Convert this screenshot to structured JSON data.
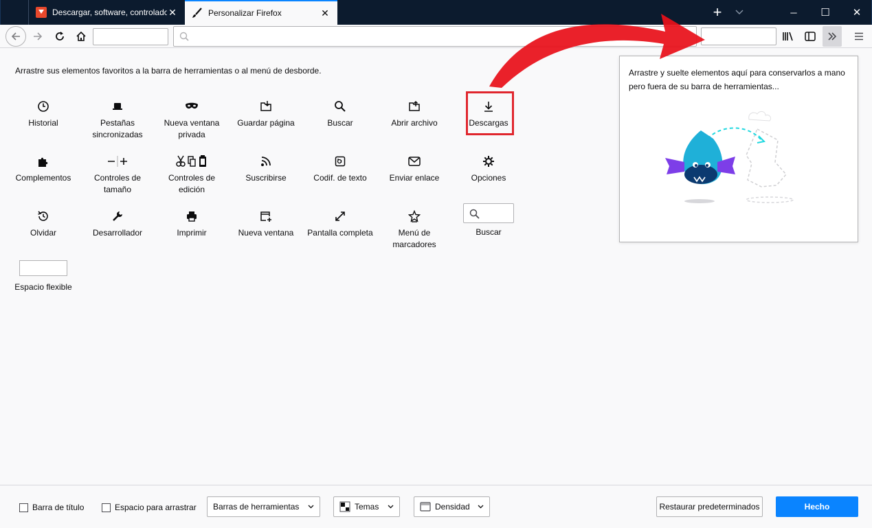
{
  "tabs": [
    {
      "label": "Descargar, software, controlado",
      "close": "✕"
    },
    {
      "label": "Personalizar Firefox",
      "close": "✕"
    }
  ],
  "window": {
    "new_tab": "+",
    "minimize": "─",
    "maximize": "☐",
    "close": "✕"
  },
  "instructions": "Arrastre sus elementos favoritos a la barra de herramientas o al menú de desborde.",
  "items": [
    {
      "label": "Historial",
      "icon": "clock-icon"
    },
    {
      "label": "Pestañas sincronizadas",
      "icon": "laptop-icon"
    },
    {
      "label": "Nueva ventana privada",
      "icon": "mask-icon"
    },
    {
      "label": "Guardar página",
      "icon": "save-page-icon"
    },
    {
      "label": "Buscar",
      "icon": "search-icon"
    },
    {
      "label": "Abrir archivo",
      "icon": "open-file-icon"
    },
    {
      "label": "Descargas",
      "icon": "download-icon"
    },
    {
      "label": "Complementos",
      "icon": "puzzle-icon"
    },
    {
      "label": "Controles de tamaño",
      "icon": "zoom-icon"
    },
    {
      "label": "Controles de edición",
      "icon": "edit-icon"
    },
    {
      "label": "Suscribirse",
      "icon": "rss-icon"
    },
    {
      "label": "Codif. de texto",
      "icon": "encoding-icon"
    },
    {
      "label": "Enviar enlace",
      "icon": "mail-icon"
    },
    {
      "label": "Opciones",
      "icon": "gear-icon"
    },
    {
      "label": "Olvidar",
      "icon": "forget-icon"
    },
    {
      "label": "Desarrollador",
      "icon": "wrench-icon"
    },
    {
      "label": "Imprimir",
      "icon": "printer-icon"
    },
    {
      "label": "Nueva ventana",
      "icon": "new-window-icon"
    },
    {
      "label": "Pantalla completa",
      "icon": "fullscreen-icon"
    },
    {
      "label": "Menú de marcadores",
      "icon": "star-icon"
    },
    {
      "label": "Buscar",
      "icon": "search-box-icon"
    },
    {
      "label": "Espacio flexible",
      "icon": "flexible-space-icon"
    }
  ],
  "overflow_panel": {
    "text": "Arrastre y suelte elementos aquí para conservarlos a mano pero fuera de su barra de herramientas..."
  },
  "footer": {
    "title_bar": "Barra de título",
    "drag_space": "Espacio para arrastrar",
    "toolbars": "Barras de herramientas",
    "themes": "Temas",
    "density": "Densidad",
    "restore": "Restaurar predeterminados",
    "done": "Hecho"
  },
  "colors": {
    "accent": "#0a84ff",
    "highlight": "#e0262d",
    "arrow": "#e8101a",
    "titlebar": "#0c1b2e"
  }
}
